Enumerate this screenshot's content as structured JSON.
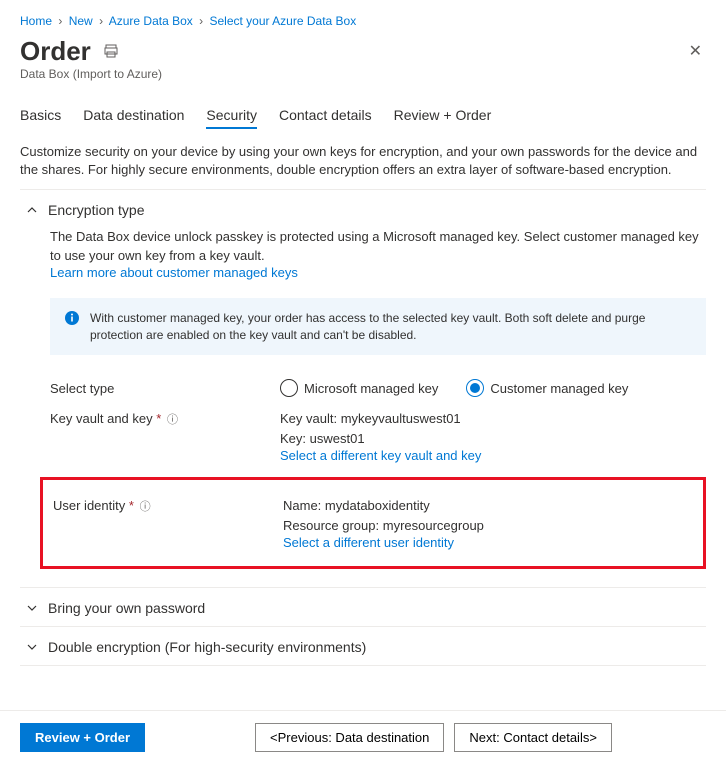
{
  "breadcrumb": [
    "Home",
    "New",
    "Azure Data Box",
    "Select your Azure Data Box"
  ],
  "page": {
    "title": "Order",
    "subtitle": "Data Box (Import to Azure)"
  },
  "tabs": {
    "basics": "Basics",
    "dest": "Data destination",
    "security": "Security",
    "contact": "Contact details",
    "review": "Review + Order"
  },
  "description": "Customize security on your device by using your own keys for encryption, and your own passwords for the device and the shares. For highly secure environments, double encryption offers an extra layer of software-based encryption.",
  "encryption": {
    "title": "Encryption type",
    "body": "The Data Box device unlock passkey is protected using a Microsoft managed key. Select customer managed key to use your own key from a key vault.",
    "learn_link": "Learn more about customer managed keys",
    "info": "With customer managed key, your order has access to the selected key vault. Both soft delete and purge protection are enabled on the key vault and can't be disabled.",
    "select_type_label": "Select type",
    "radio_ms": "Microsoft managed key",
    "radio_cust": "Customer managed key",
    "kv_label": "Key vault and key",
    "kv_vault_label": "Key vault:",
    "kv_vault_value": "mykeyvaultuswest01",
    "kv_key_label": "Key:",
    "kv_key_value": "uswest01",
    "kv_link": "Select a different key vault and key",
    "uid_label": "User identity",
    "uid_name_label": "Name:",
    "uid_name_value": "mydataboxidentity",
    "uid_rg_label": "Resource group:",
    "uid_rg_value": "myresourcegroup",
    "uid_link": "Select a different user identity"
  },
  "sections": {
    "byop": "Bring your own password",
    "dbl": "Double encryption (For high-security environments)"
  },
  "footer": {
    "review": "Review + Order",
    "prev": "<Previous: Data destination",
    "next": "Next: Contact details>"
  }
}
